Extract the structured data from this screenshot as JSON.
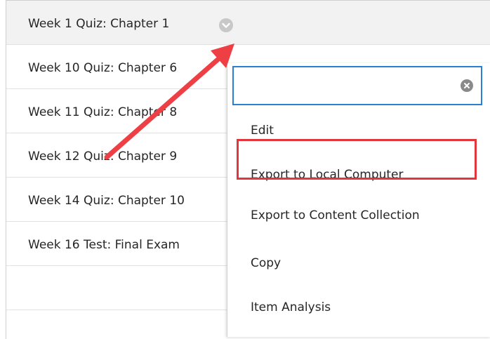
{
  "rows": [
    {
      "title": "Week 1 Quiz: Chapter 1"
    },
    {
      "title": "Week 10 Quiz: Chapter 6"
    },
    {
      "title": "Week 11 Quiz: Chapter 8"
    },
    {
      "title": "Week 12 Quiz: Chapter 9"
    },
    {
      "title": "Week 14 Quiz: Chapter 10"
    },
    {
      "title": "Week 16 Test: Final Exam"
    }
  ],
  "menu": {
    "search_value": "",
    "items": [
      {
        "label": "Edit"
      },
      {
        "label": "Export to Local Computer"
      },
      {
        "label": "Export to Content Collection"
      },
      {
        "label": "Copy"
      },
      {
        "label": "Item Analysis"
      }
    ]
  },
  "icons": {
    "row_menu": "chevron-down-icon",
    "clear": "clear-icon"
  },
  "colors": {
    "focus_border": "#2a7fd4",
    "highlight_box": "#e2353c",
    "annotation_arrow": "#ee3f45",
    "first_row_bg": "#f2f2f2"
  }
}
